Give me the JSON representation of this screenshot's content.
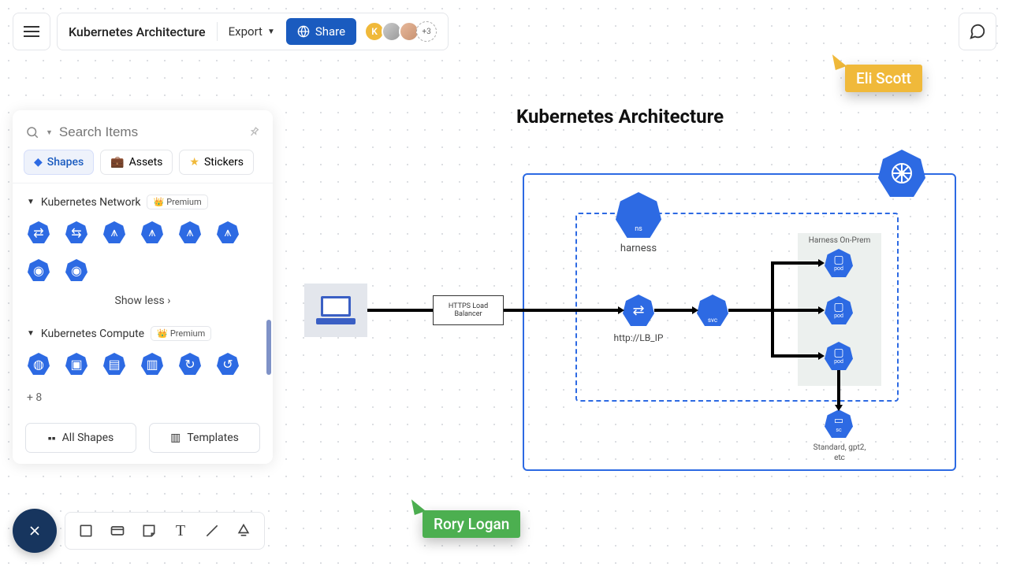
{
  "toolbar": {
    "title": "Kubernetes Architecture",
    "export_label": "Export",
    "share_label": "Share",
    "avatar_initial": "K",
    "avatar_extra": "+3"
  },
  "panel": {
    "search_placeholder": "Search Items",
    "tabs": {
      "shapes": "Shapes",
      "assets": "Assets",
      "stickers": "Stickers"
    },
    "group1": {
      "title": "Kubernetes Network",
      "badge": "Premium",
      "show_less": "Show less"
    },
    "group2": {
      "title": "Kubernetes Compute",
      "badge": "Premium",
      "more": "+ 8"
    },
    "all_shapes": "All Shapes",
    "templates": "Templates"
  },
  "diagram": {
    "title": "Kubernetes Architecture",
    "ns_label": "ns",
    "ns_caption": "harness",
    "lb_text": "HTTPS Load Balancer",
    "ing_caption": "http://LB_IP",
    "svc_label": "svc",
    "harness_title": "Harness On-Prem",
    "pod_label": "pod",
    "sc_label": "sc",
    "sc_caption": "Standard, gpt2, etc"
  },
  "cursors": {
    "eli": "Eli Scott",
    "rory": "Rory Logan"
  }
}
